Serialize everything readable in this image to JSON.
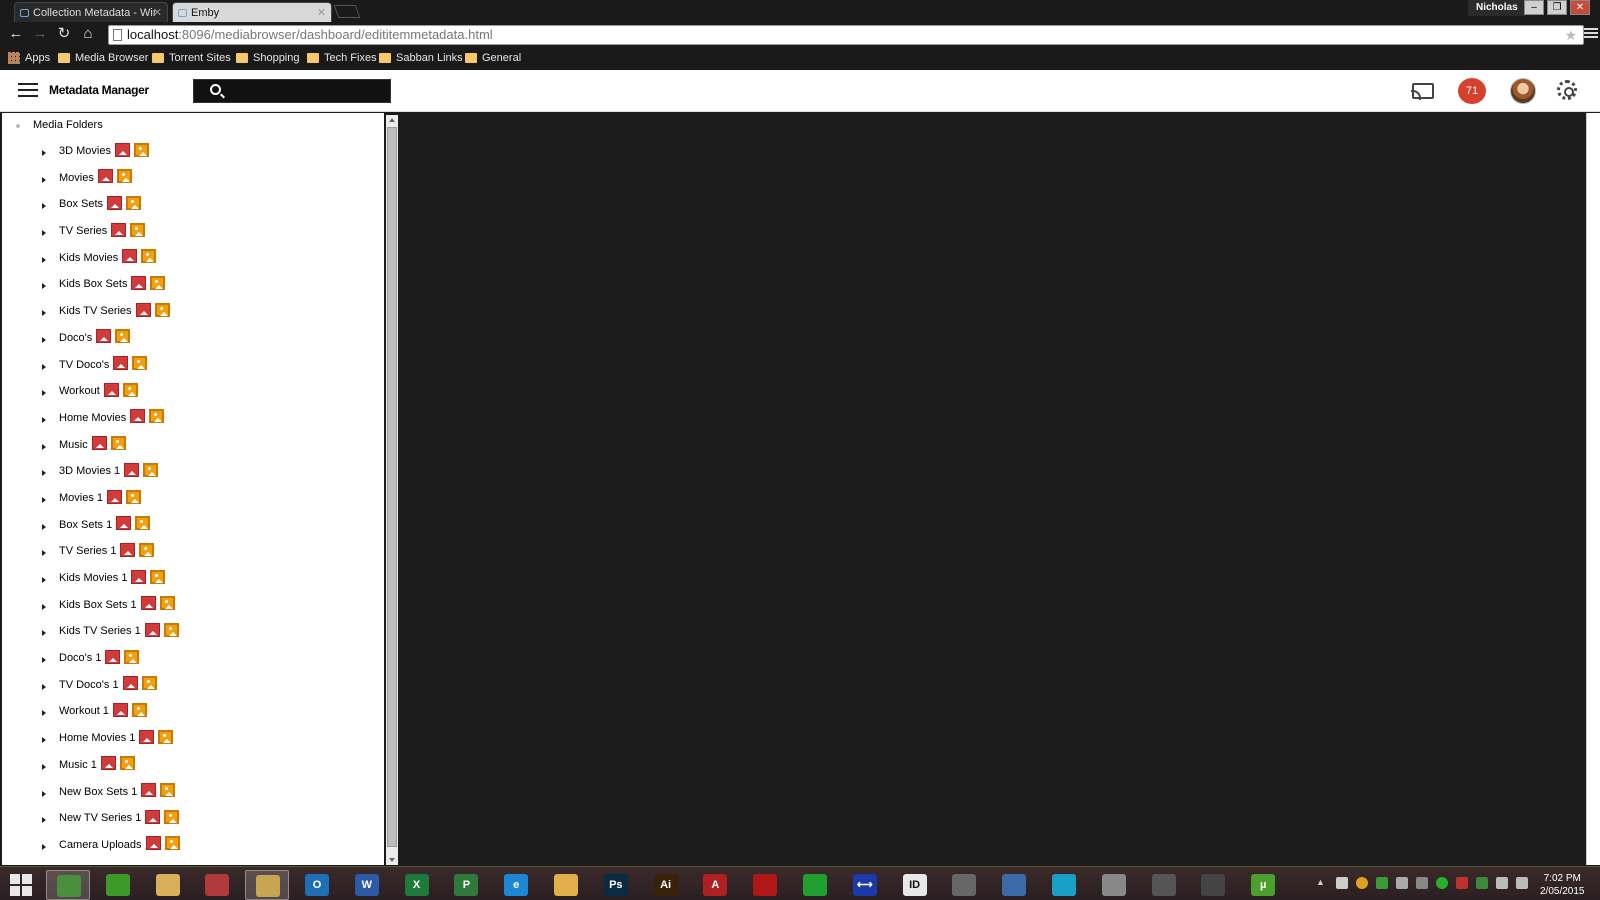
{
  "browser": {
    "tabs": [
      {
        "title": "Collection Metadata - Wir",
        "active": false
      },
      {
        "title": "Emby",
        "active": true
      }
    ],
    "user": "Nicholas",
    "url_host": "localhost",
    "url_rest": ":8096/mediabrowser/dashboard/edititemmetadata.html",
    "window_buttons": {
      "minimize": "–",
      "restore": "❐",
      "close": "✕"
    },
    "bookmarks": [
      {
        "label": "Apps",
        "icon": "apps-icon"
      },
      {
        "label": "Media Browser",
        "icon": "folder-icon"
      },
      {
        "label": "Torrent Sites",
        "icon": "folder-icon"
      },
      {
        "label": "Shopping",
        "icon": "folder-icon"
      },
      {
        "label": "Tech Fixes",
        "icon": "folder-icon"
      },
      {
        "label": "Sabban Links",
        "icon": "folder-icon"
      },
      {
        "label": "General",
        "icon": "folder-icon"
      }
    ]
  },
  "header": {
    "title": "Metadata Manager",
    "search_placeholder": "",
    "notification_count": "71",
    "accent": "#d5412b"
  },
  "tree": {
    "root_label": "Media Folders",
    "items": [
      "3D Movies",
      "Movies",
      "Box Sets",
      "TV Series",
      "Kids Movies",
      "Kids Box Sets",
      "Kids TV Series",
      "Doco's",
      "TV Doco's",
      "Workout",
      "Home Movies",
      "Music",
      "3D Movies 1",
      "Movies 1",
      "Box Sets 1",
      "TV Series 1",
      "Kids Movies 1",
      "Kids Box Sets 1",
      "Kids TV Series 1",
      "Doco's 1",
      "TV Doco's 1",
      "Workout 1",
      "Home Movies 1",
      "Music 1",
      "New Box Sets 1",
      "New TV Series 1",
      "Camera Uploads"
    ],
    "status_icons": [
      "image-missing-icon",
      "image-present-icon"
    ],
    "status_colors": {
      "missing": "#d23b3b",
      "present": "#f1a013"
    }
  },
  "taskbar": {
    "apps": [
      {
        "name": "chrome",
        "label": "",
        "color": "#4a8f3c",
        "active": true
      },
      {
        "name": "media-center",
        "label": "",
        "color": "#3c9a2a"
      },
      {
        "name": "file-explorer",
        "label": "",
        "color": "#d9b05a"
      },
      {
        "name": "snipping-tool",
        "label": "",
        "color": "#b03a3a"
      },
      {
        "name": "explorer-folder",
        "label": "",
        "color": "#c9a451",
        "active": true
      },
      {
        "name": "outlook",
        "label": "O",
        "color": "#1f6fb8"
      },
      {
        "name": "word",
        "label": "W",
        "color": "#2a5aa8"
      },
      {
        "name": "excel",
        "label": "X",
        "color": "#1e7a3b"
      },
      {
        "name": "project",
        "label": "P",
        "color": "#2f7a3b"
      },
      {
        "name": "internet-explorer",
        "label": "e",
        "color": "#1b88d6"
      },
      {
        "name": "notepad",
        "label": "",
        "color": "#e0b04a"
      },
      {
        "name": "photoshop",
        "label": "Ps",
        "color": "#0b2a44"
      },
      {
        "name": "illustrator",
        "label": "Ai",
        "color": "#3a2208"
      },
      {
        "name": "acrobat",
        "label": "A",
        "color": "#b02020"
      },
      {
        "name": "filezilla",
        "label": "",
        "color": "#b01818"
      },
      {
        "name": "spotify-green",
        "label": "",
        "color": "#1f9f2f"
      },
      {
        "name": "teamviewer",
        "label": "⟷",
        "color": "#1a3aaa"
      },
      {
        "name": "indesign",
        "label": "ID",
        "color": "#e8e8e8"
      },
      {
        "name": "vm-app",
        "label": "",
        "color": "#666666"
      },
      {
        "name": "network-app",
        "label": "",
        "color": "#3a6aa8"
      },
      {
        "name": "search-app",
        "label": "",
        "color": "#1aa0c8"
      },
      {
        "name": "satellite-app",
        "label": "",
        "color": "#888888"
      },
      {
        "name": "vpn-app",
        "label": "",
        "color": "#555555"
      },
      {
        "name": "speedtest-app",
        "label": "",
        "color": "#444444"
      },
      {
        "name": "utorrent",
        "label": "µ",
        "color": "#4aa02a"
      }
    ],
    "time": "7:02 PM",
    "date": "2/05/2015"
  }
}
